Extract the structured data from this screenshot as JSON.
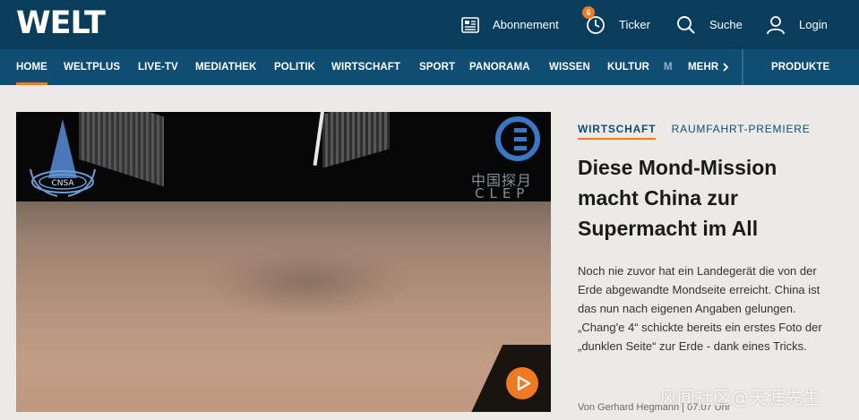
{
  "header": {
    "logo": "WELT",
    "abonnement_label": "Abonnement",
    "ticker_label": "Ticker",
    "ticker_badge": "6",
    "suche_label": "Suche",
    "login_label": "Login"
  },
  "nav": {
    "items": [
      {
        "label": "HOME",
        "active": true
      },
      {
        "label": "WELTPLUS"
      },
      {
        "label": "LIVE-TV"
      },
      {
        "label": "MEDIATHEK"
      },
      {
        "label": "POLITIK"
      },
      {
        "label": "WIRTSCHAFT"
      },
      {
        "label": "SPORT"
      },
      {
        "label": "PANORAMA"
      },
      {
        "label": "WISSEN"
      },
      {
        "label": "KULTUR"
      },
      {
        "label": "M"
      }
    ],
    "mehr_label": "MEHR",
    "produkte_label": "PRODUKTE"
  },
  "hero": {
    "cnsa_text": "CNSA",
    "clep_chinese": "中国探月",
    "clep_english": "CLEP",
    "play_icon": "play-icon"
  },
  "article": {
    "category": "WIRTSCHAFT",
    "topic": "RAUMFAHRT-PREMIERE",
    "headline": "Diese Mond-Mission macht China zur Supermacht im All",
    "teaser": "Noch nie zuvor hat ein Landegerät die von der Erde abgewandte Mondseite erreicht. China ist das nun nach eigenen Angaben gelungen. „Chang'e 4“ schickte bereits ein erstes Foto der „dunklen Seite“ zur Erde - dank eines Tricks.",
    "byline": "Von Gerhard Hegmann | 07:07 Uhr"
  },
  "watermark": "风闻社区@天涯先生",
  "colors": {
    "header_bg": "#0a3d5c",
    "nav_bg": "#0f4d73",
    "accent": "#f07a22",
    "page_bg": "#eceae6"
  }
}
